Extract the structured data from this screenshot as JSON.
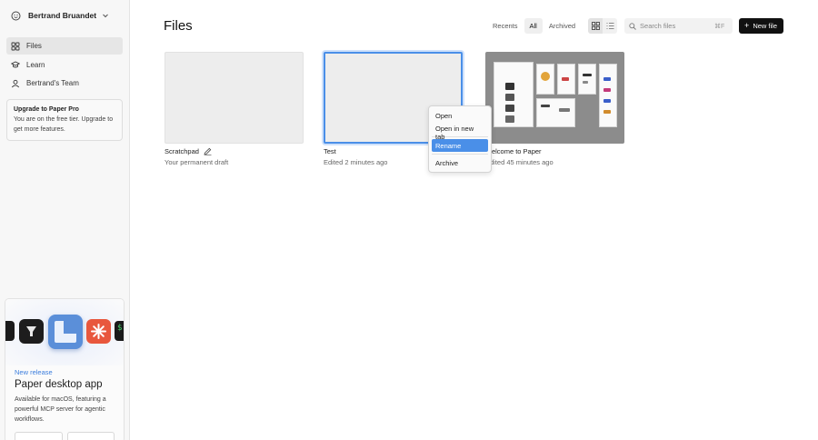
{
  "account": {
    "name": "Bertrand Bruandet"
  },
  "sidebar": {
    "items": [
      {
        "label": "Files",
        "active": true,
        "icon": "grid-icon"
      },
      {
        "label": "Learn",
        "active": false,
        "icon": "graduation-cap-icon"
      },
      {
        "label": "Bertrand's Team",
        "active": false,
        "icon": "team-icon"
      }
    ],
    "upgrade": {
      "title": "Upgrade to Paper Pro",
      "text": "You are on the free tier. Upgrade to get more features."
    },
    "promo": {
      "tag": "New release",
      "title": "Paper desktop app",
      "text": "Available for macOS, featuring a powerful MCP server for agentic workflows."
    }
  },
  "main": {
    "title": "Files",
    "tabs": [
      {
        "label": "Recents",
        "selected": false
      },
      {
        "label": "All",
        "selected": true
      },
      {
        "label": "Archived",
        "selected": false
      }
    ],
    "search": {
      "placeholder": "Search files",
      "shortcut": "⌘F"
    },
    "new_file_label": "New file",
    "files": [
      {
        "name": "Scratchpad",
        "meta": "Your permanent draft"
      },
      {
        "name": "Test",
        "meta": "Edited 2 minutes ago"
      },
      {
        "name": "Welcome to Paper",
        "meta": "Edited 45 minutes ago"
      }
    ]
  },
  "context_menu": {
    "items": [
      "Open",
      "Open in new tab",
      "Rename",
      "Archive"
    ],
    "highlighted": "Rename"
  },
  "colors": {
    "accent": "#4a8fe8",
    "promo_tag": "#3b7ddd",
    "primary_button": "#111111"
  }
}
